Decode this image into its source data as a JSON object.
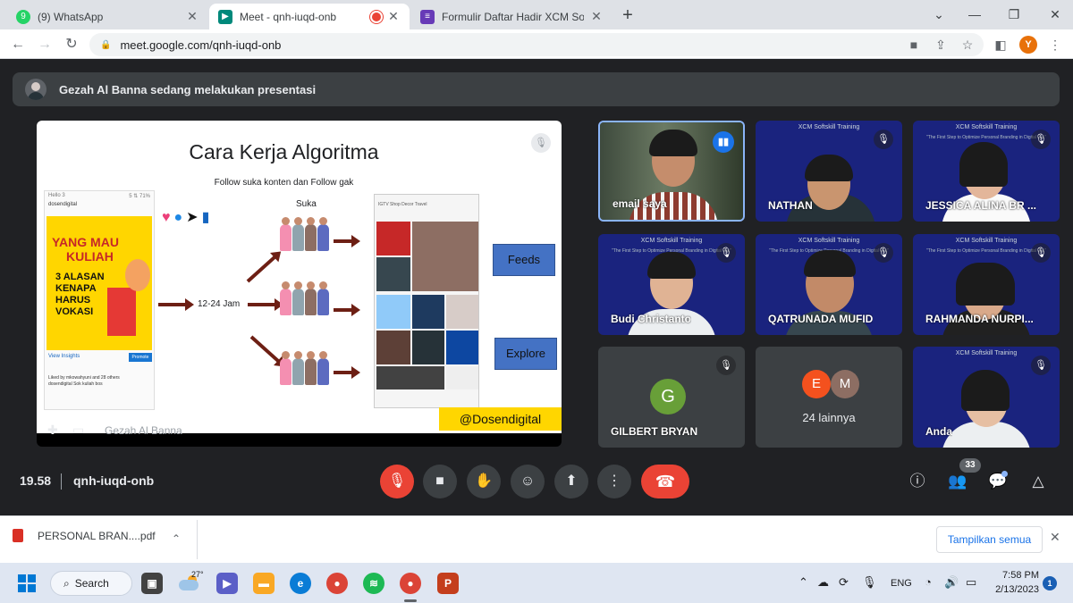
{
  "browser": {
    "tabs": [
      {
        "title": "(9) WhatsApp",
        "favicon": "whatsapp-icon",
        "badge": "9"
      },
      {
        "title": "Meet - qnh-iuqd-onb",
        "favicon": "meet-icon"
      },
      {
        "title": "Formulir Daftar Hadir XCM Softskill",
        "favicon": "forms-icon"
      }
    ],
    "url": "meet.google.com/qnh-iuqd-onb",
    "profile_initial": "Y"
  },
  "meet": {
    "banner_text": "Gezah Al Banna sedang melakukan presentasi",
    "presenter_name": "Gezah Al Banna",
    "slide": {
      "title": "Cara Kerja Algoritma",
      "subtitle": "Follow suka konten dan Follow gak",
      "suka_label": "Suka",
      "time_label": "12-24 Jam",
      "feeds_label": "Feeds",
      "explore_label": "Explore",
      "handle": "@Dosendigital",
      "phone": {
        "status_left": "Hello 3",
        "status_right": "5 ⇅ 71%",
        "account": "dosendigital",
        "poster_top": [
          "YANG MAU",
          "KULIAH"
        ],
        "poster_body": [
          "3 ALASAN",
          "KENAPA",
          "HARUS",
          "VOKASI"
        ],
        "view_insights": "View Insights",
        "promote": "Promote",
        "liked_by": "Liked by mkowahyuni and 28 others",
        "caption": "dosendigital Sok kuliah bos"
      },
      "grid_chips": "IGTV   Shop   Decor   Travel"
    },
    "tiles": [
      {
        "name": "email saya",
        "type": "video",
        "speaking": true
      },
      {
        "name": "NATHAN",
        "type": "video",
        "header": "XCM Softskill Training"
      },
      {
        "name": "JESSICA ALINA BR ...",
        "type": "video",
        "header": "XCM Softskill Training",
        "subheader": "\"The First Step to Optimize Personal Branding in Digital Era\""
      },
      {
        "name": "Budi Christanto",
        "type": "video",
        "header": "XCM Softskill Training",
        "subheader": "\"The First Step to Optimize Personal Branding in Digital Era\""
      },
      {
        "name": "QATRUNADA MUFID",
        "type": "video",
        "header": "XCM Softskill Training",
        "subheader": "\"The First Step to Optimize Personal Branding in Digital Era\""
      },
      {
        "name": "RAHMANDA NURPI...",
        "type": "video",
        "header": "XCM Softskill Training",
        "subheader": "\"The First Step to Optimize Personal Branding in Digital Era\""
      },
      {
        "name": "GILBERT BRYAN",
        "type": "avatar",
        "initial": "G"
      },
      {
        "name": "24 lainnya",
        "type": "others",
        "initials": [
          "E",
          "M"
        ]
      },
      {
        "name": "Anda",
        "type": "video",
        "header": "XCM Softskill Training"
      }
    ],
    "clock": "19.58",
    "meeting_code": "qnh-iuqd-onb",
    "participant_count": "33"
  },
  "downloads": {
    "file": "PERSONAL BRAN....pdf",
    "show_all": "Tampilkan semua"
  },
  "taskbar": {
    "search_label": "Search",
    "weather_temp": "27°",
    "language": "ENG",
    "time": "7:58 PM",
    "date": "2/13/2023",
    "notification_count": "1"
  }
}
